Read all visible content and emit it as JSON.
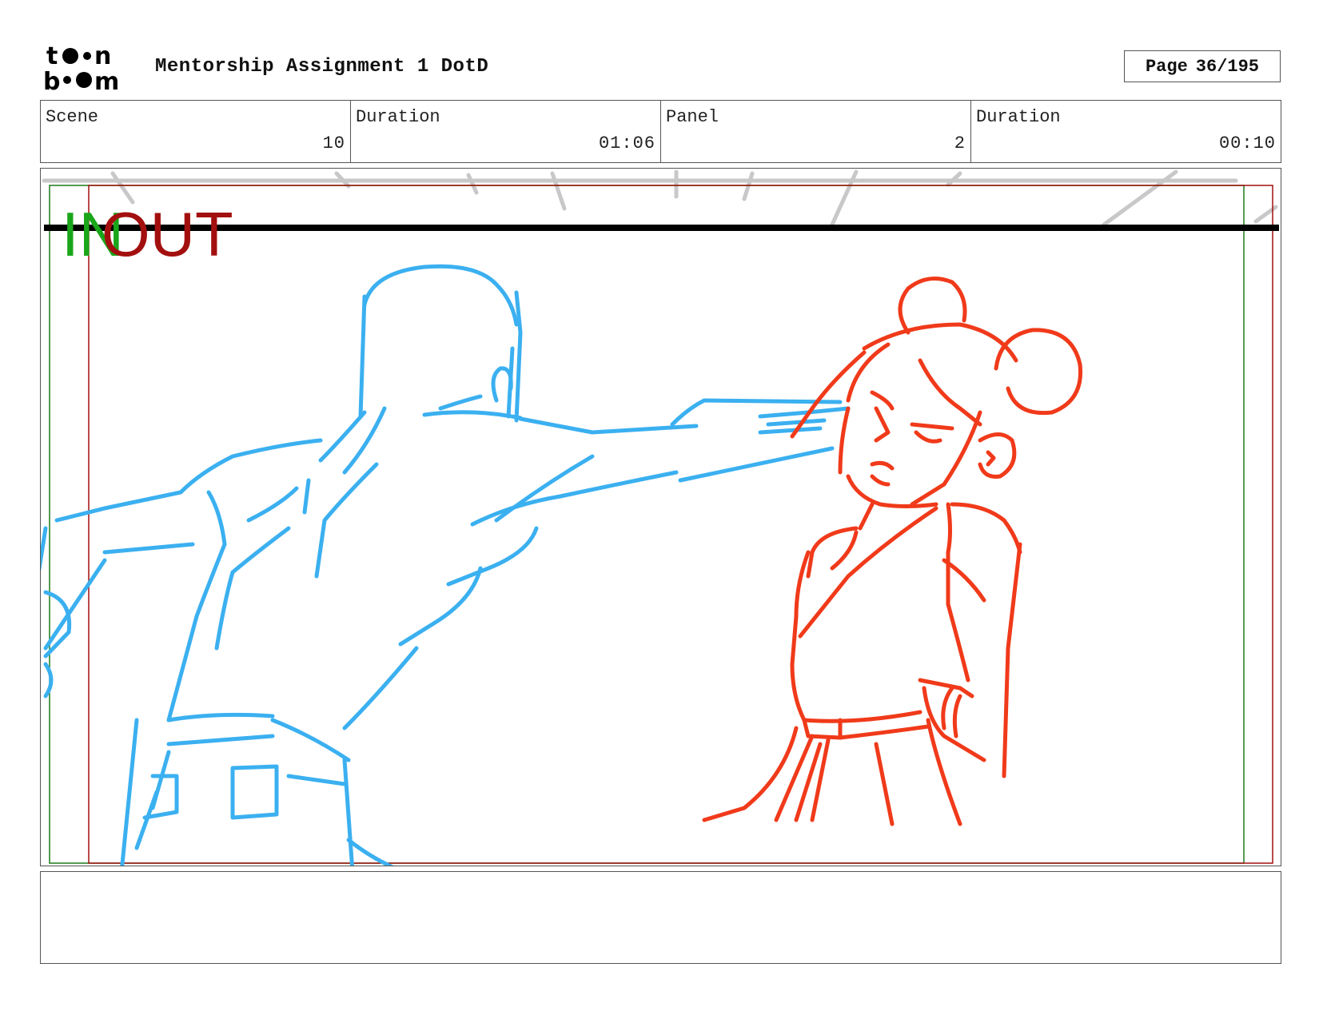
{
  "header": {
    "logo_text": "toon boom",
    "title": "Mentorship Assignment 1 DotD",
    "page_label": "Page",
    "page_value": "36/195"
  },
  "info": {
    "scene_label": "Scene",
    "scene_value": "10",
    "scene_duration_label": "Duration",
    "scene_duration_value": "01:06",
    "panel_label": "Panel",
    "panel_value": "2",
    "panel_duration_label": "Duration",
    "panel_duration_value": "00:10"
  },
  "panel": {
    "in_label": "IN",
    "out_label": "OUT",
    "in_color": "#1aa61a",
    "out_color": "#a30f0f",
    "figure_left_color": "#3bb0f0",
    "figure_right_color": "#f03a1a",
    "figure_left": "blue-sketch-figure-punching",
    "figure_right": "red-sketch-girl-with-hair-buns"
  },
  "notes": {
    "text": ""
  }
}
